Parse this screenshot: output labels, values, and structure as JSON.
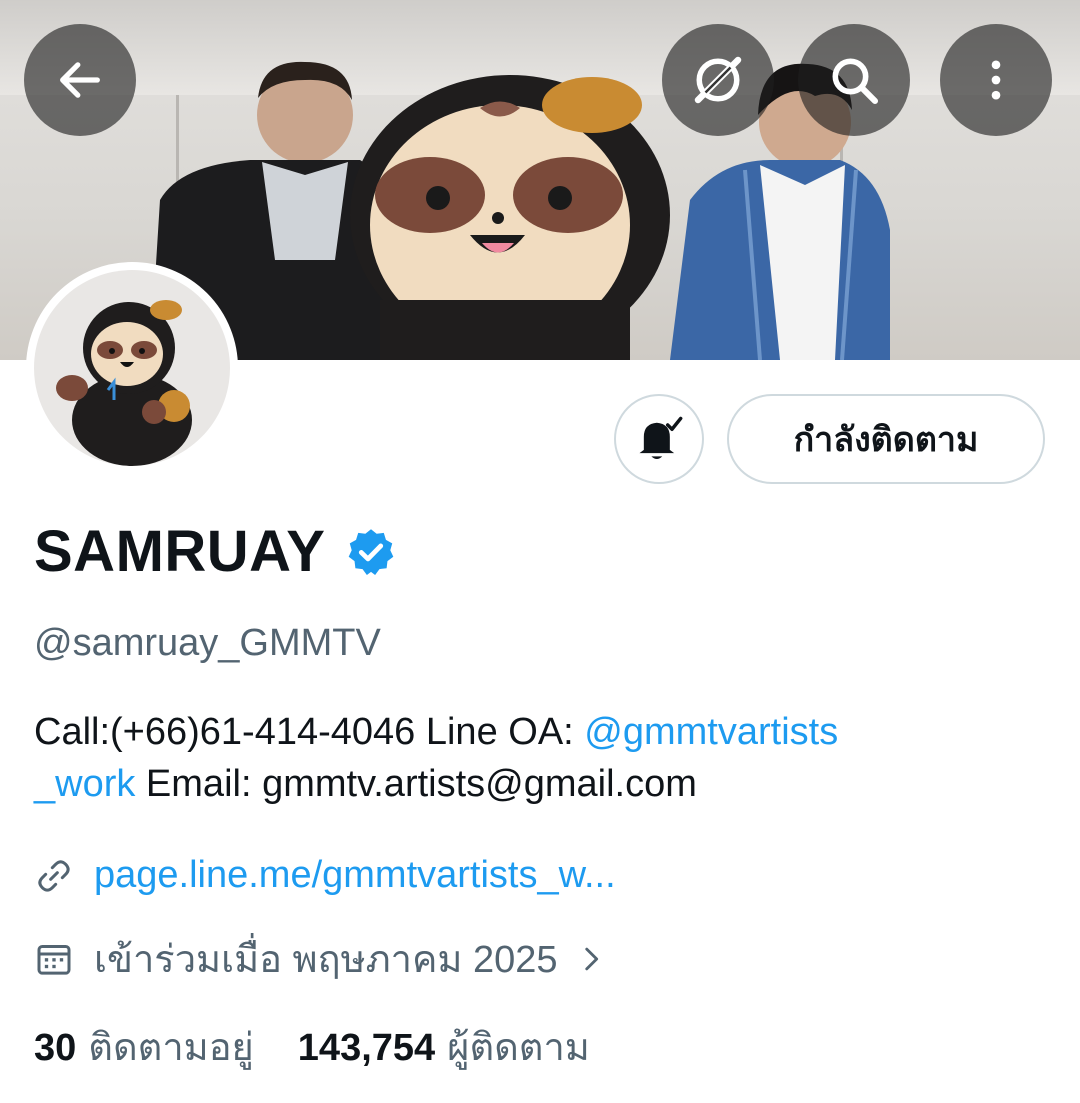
{
  "header": {
    "back_icon": "arrow-left-icon",
    "grok_icon": "grok-icon",
    "search_icon": "search-icon",
    "more_icon": "more-vertical-icon"
  },
  "profile": {
    "name": "SAMRUAY",
    "verified": true,
    "handle": "@samruay_GMMTV",
    "bio_prefix": "Call:(+66)61-414-4046 Line OA: ",
    "bio_mention": "@gmmtvartists_work",
    "bio_mention_line1": "@gmmtvartists",
    "bio_mention_line2": "_work",
    "bio_suffix": " Email: gmmtv.artists@gmail.com",
    "website": "page.line.me/gmmtvartists_w...",
    "joined": "เข้าร่วมเมื่อ พฤษภาคม 2025",
    "following_count": "30",
    "following_label": "ติดตามอยู่",
    "followers_count": "143,754",
    "followers_label": "ผู้ติดตาม"
  },
  "actions": {
    "notify_icon": "bell-check-icon",
    "follow_label": "กำลังติดตาม"
  },
  "colors": {
    "accent": "#1d9bf0",
    "text": "#0f1419",
    "muted": "#536471",
    "border": "#cfd9de"
  }
}
